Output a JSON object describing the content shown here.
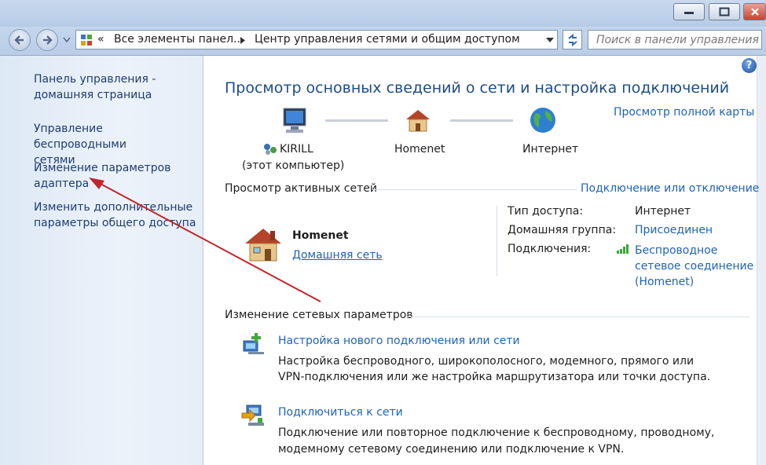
{
  "address": {
    "overflow": "«",
    "crumb1": "Все элементы панел...",
    "crumb2": "Центр управления сетями и общим доступом"
  },
  "search": {
    "placeholder": "Поиск в панели управления"
  },
  "sidebar": {
    "items": [
      {
        "line1": "Панель управления -",
        "line2": "домашняя страница"
      },
      {
        "line1": "Управление беспроводными",
        "line2": "сетями"
      },
      {
        "line1": "Изменение параметров",
        "line2": "адаптера"
      },
      {
        "line1": "Изменить дополнительные",
        "line2": "параметры общего доступа"
      }
    ]
  },
  "main": {
    "title": "Просмотр основных сведений о сети и настройка подключений",
    "full_map_link": "Просмотр полной карты",
    "map": {
      "computer_name": "KIRILL",
      "computer_sub": "(этот компьютер)",
      "network_name": "Homenet",
      "internet": "Интернет"
    },
    "active": {
      "heading": "Просмотр активных сетей",
      "connect_link": "Подключение или отключение",
      "network_name": "Homenet",
      "network_type": "Домашняя сеть",
      "access_label": "Тип доступа:",
      "access_value": "Интернет",
      "homegroup_label": "Домашняя группа:",
      "homegroup_value": "Присоединен",
      "connections_label": "Подключения:",
      "connection_line1": "Беспроводное",
      "connection_line2": "сетевое соединение",
      "connection_line3": "(Homenet)"
    },
    "change": {
      "heading": "Изменение сетевых параметров",
      "tasks": [
        {
          "title": "Настройка нового подключения или сети",
          "desc1": "Настройка беспроводного, широкополосного, модемного, прямого или",
          "desc2": "VPN-подключения или же настройка маршрутизатора или точки доступа."
        },
        {
          "title": "Подключиться к сети",
          "desc1": "Подключение или повторное подключение к беспроводному, проводному,",
          "desc2": "модемному сетевому соединению или подключение к VPN."
        }
      ]
    }
  },
  "colors": {
    "link": "#1e63b5",
    "title": "#1e4c84",
    "arrow": "#c0262a"
  }
}
